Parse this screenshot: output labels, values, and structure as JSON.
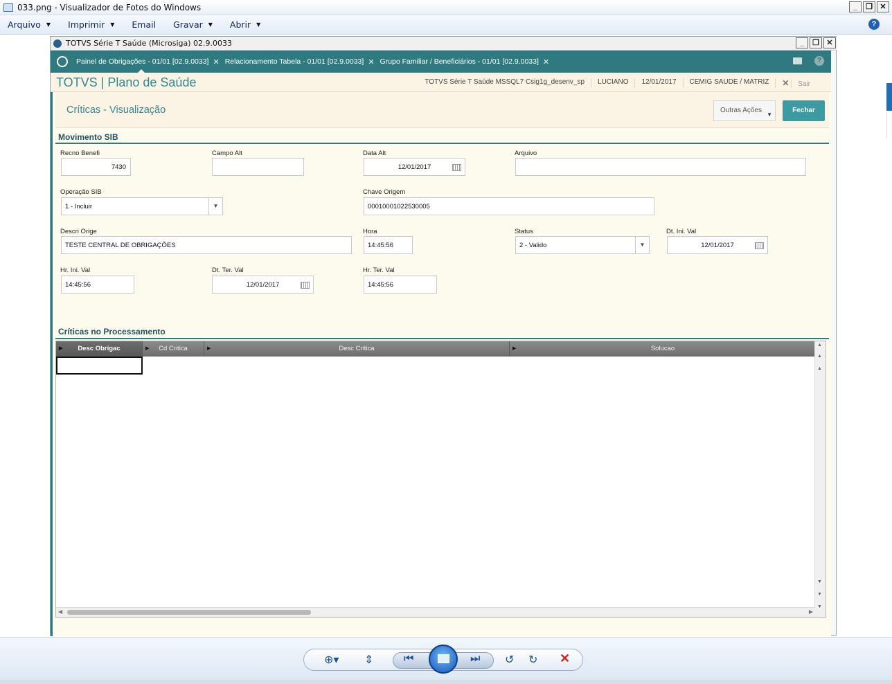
{
  "window": {
    "title": "033.png - Visualizador de Fotos do Windows",
    "menu": [
      {
        "label": "Arquivo",
        "has_arrow": true
      },
      {
        "label": "Imprimir",
        "has_arrow": true
      },
      {
        "label": "Email",
        "has_arrow": false
      },
      {
        "label": "Gravar",
        "has_arrow": true
      },
      {
        "label": "Abrir",
        "has_arrow": true
      }
    ]
  },
  "app": {
    "title": "TOTVS Série T Saúde (Microsiga) 02.9.0033",
    "tabs": [
      {
        "label": "Painel de Obrigações - 01/01 [02.9.0033]",
        "active": true
      },
      {
        "label": "Relacionamento Tabela - 01/01 [02.9.0033]",
        "active": false
      },
      {
        "label": "Grupo Familiar / Beneficiários - 01/01 [02.9.0033]",
        "active": false
      }
    ],
    "brand": "TOTVS | Plano de Saúde",
    "env": "TOTVS Série T Saúde MSSQL7 Csig1g_desenv_sp",
    "user": "LUCIANO",
    "date": "12/01/2017",
    "company": "CEMIG SAUDE / MATRIZ",
    "exit_label": "Sair"
  },
  "page": {
    "title": "Críticas - Visualização",
    "other_actions": "Outras Ações",
    "close_label": "Fechar"
  },
  "form": {
    "section1": "Movimento SIB",
    "recno_label": "Recno Benefi",
    "recno_value": "7430",
    "campo_label": "Campo Alt",
    "campo_value": "",
    "data_alt_label": "Data Alt",
    "data_alt_value": "12/01/2017",
    "arquivo_label": "Arquivo",
    "arquivo_value": "",
    "operacao_label": "Operação SIB",
    "operacao_value": "1 - Incluir",
    "chave_label": "Chave Origem",
    "chave_value": "00010001022530005",
    "descri_label": "Descri Orige",
    "descri_value": "TESTE CENTRAL DE OBRIGAÇÕES",
    "hora_label": "Hora",
    "hora_value": "14:45:56",
    "status_label": "Status",
    "status_value": "2 - Valido",
    "dt_ini_label": "Dt. Ini. Val",
    "dt_ini_value": "12/01/2017",
    "hr_ini_label": "Hr. Ini. Val",
    "hr_ini_value": "14:45:56",
    "dt_ter_label": "Dt. Ter. Val",
    "dt_ter_value": "12/01/2017",
    "hr_ter_label": "Hr. Ter. Val",
    "hr_ter_value": "14:45:56"
  },
  "grid": {
    "section2": "Críticas no Processamento",
    "columns": [
      "Desc Obrigac",
      "Cd Critica",
      "Desc Critica",
      "Solucao"
    ],
    "rows": []
  }
}
